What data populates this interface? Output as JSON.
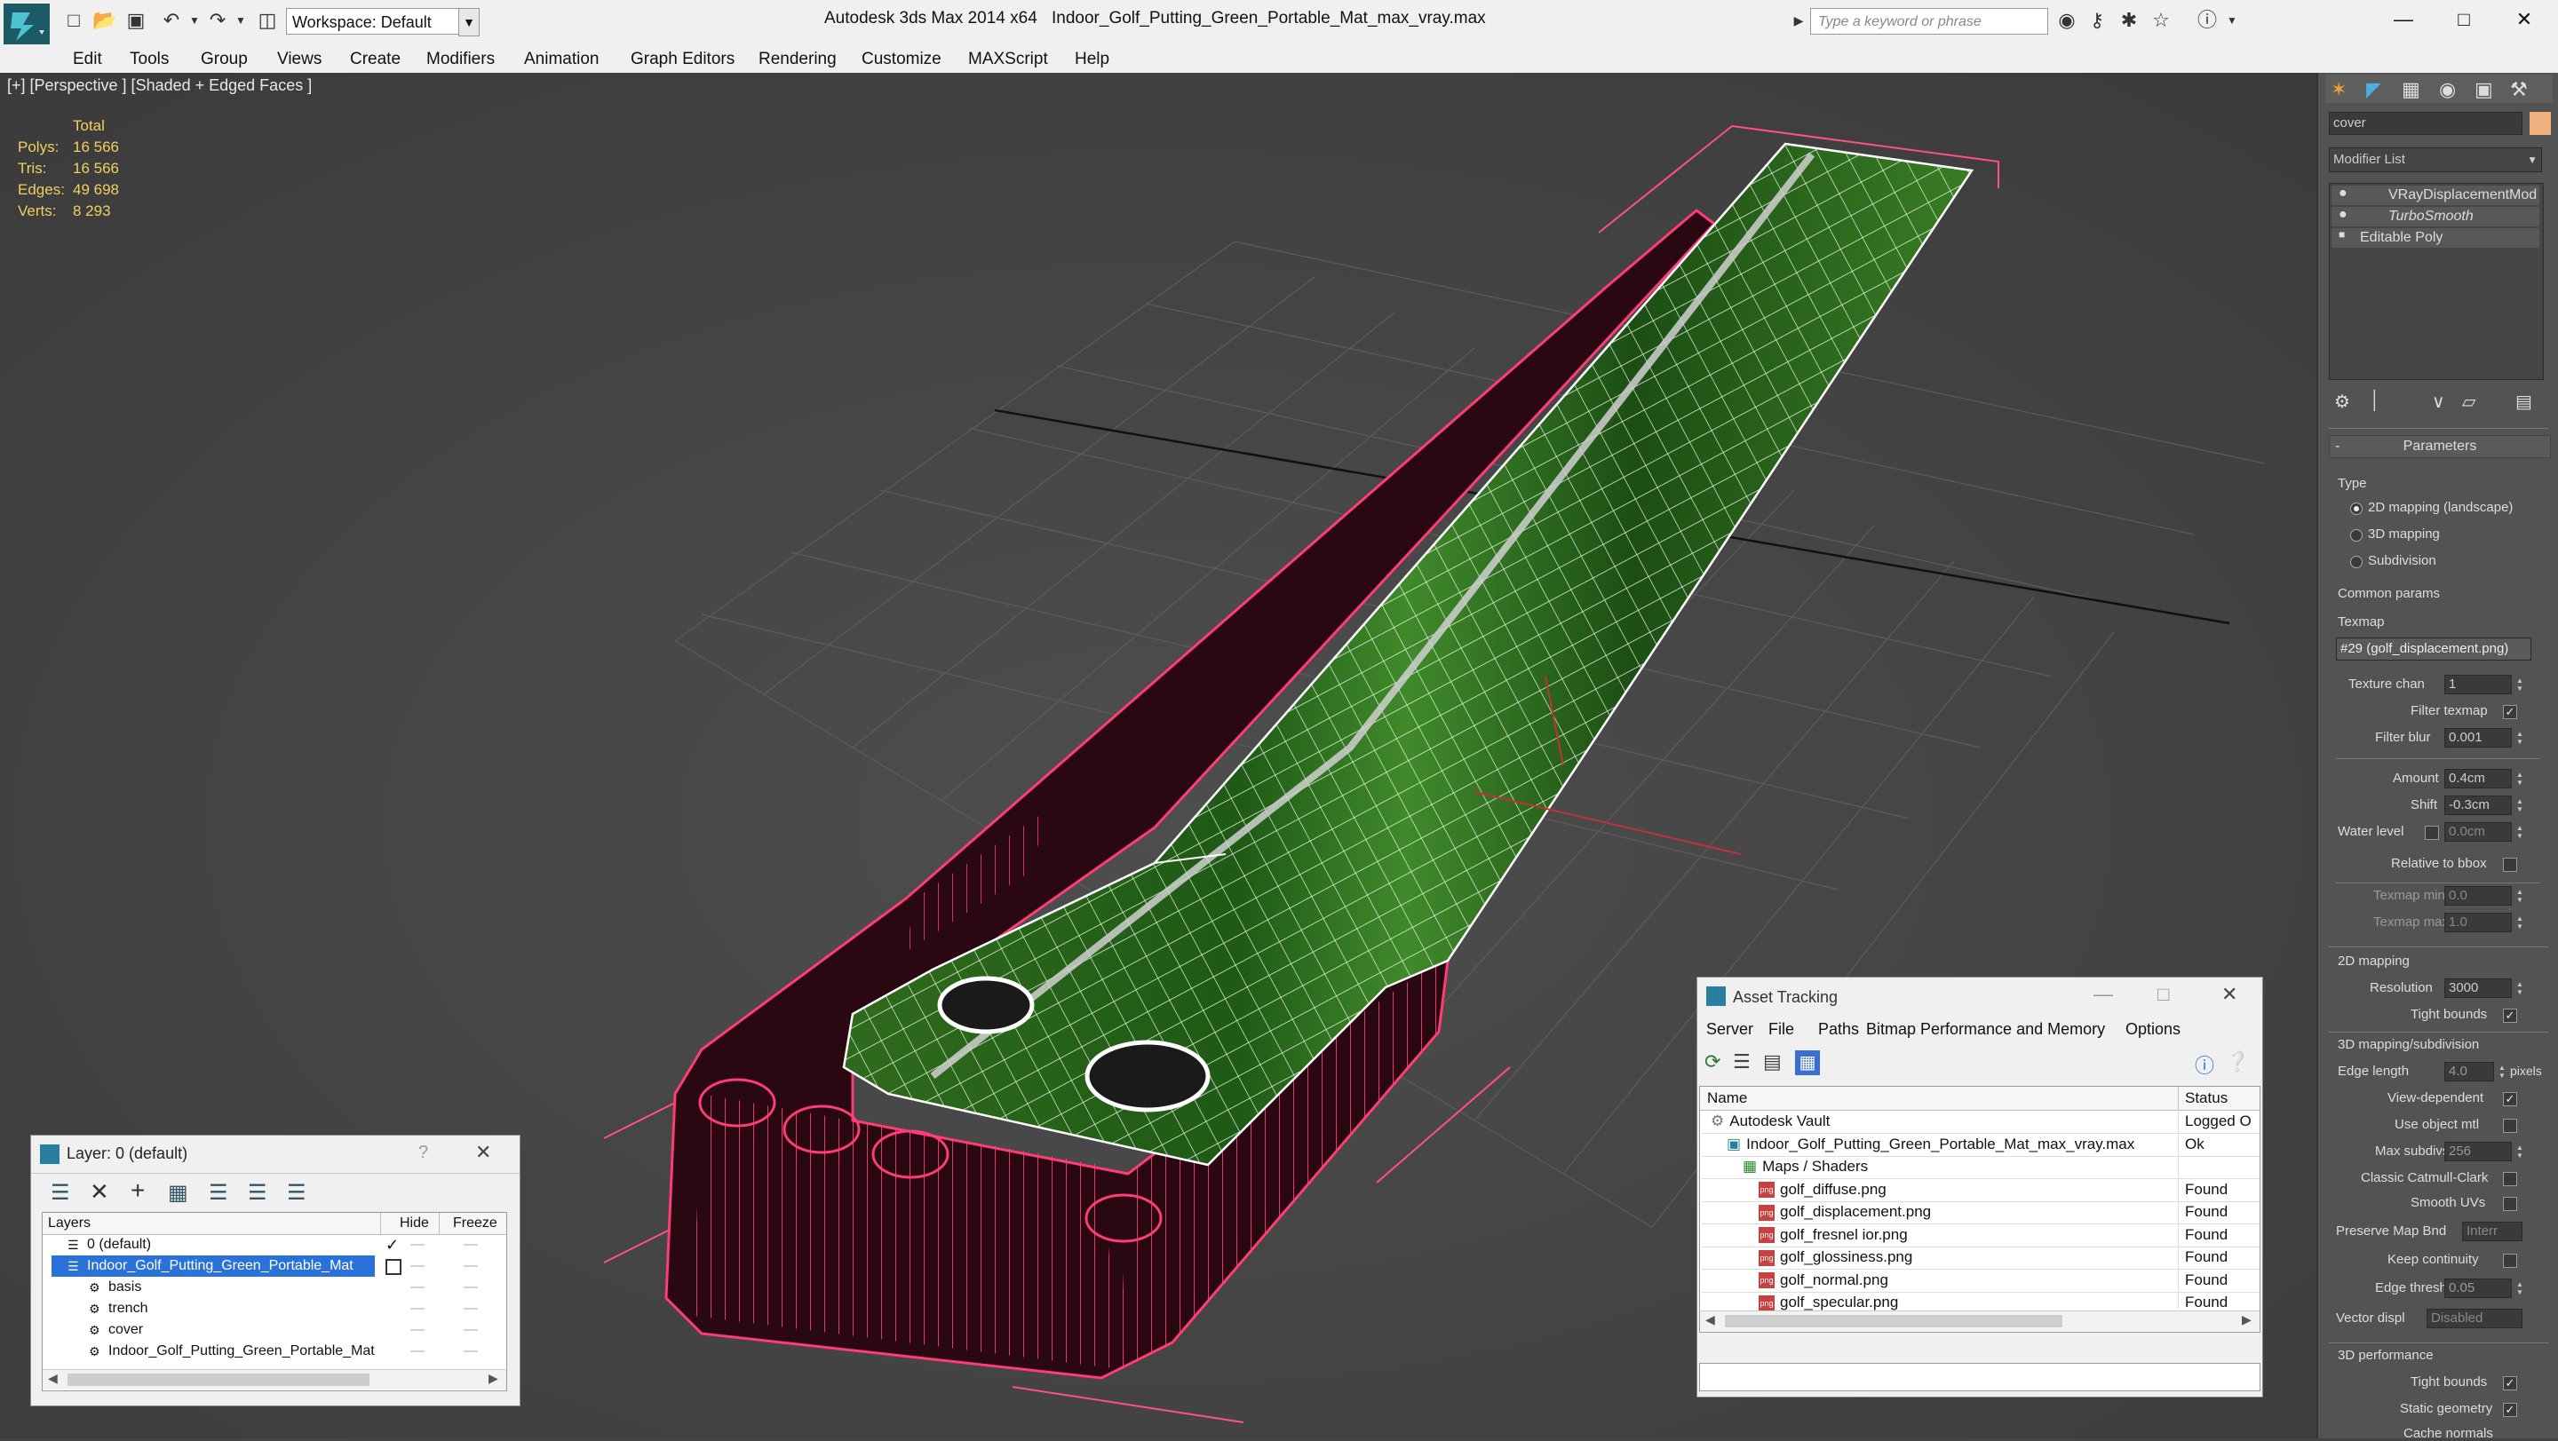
{
  "titlebar": {
    "workspace": "Workspace: Default",
    "app_title": "Autodesk 3ds Max  2014 x64",
    "file_title": "Indoor_Golf_Putting_Green_Portable_Mat_max_vray.max",
    "search_placeholder": "Type a keyword or phrase"
  },
  "menubar": [
    "Edit",
    "Tools",
    "Group",
    "Views",
    "Create",
    "Modifiers",
    "Animation",
    "Graph Editors",
    "Rendering",
    "Customize",
    "MAXScript",
    "Help"
  ],
  "viewport": {
    "label": "[+] [Perspective ] [Shaded + Edged Faces ]",
    "stats_header": "Total",
    "stats": [
      {
        "label": "Polys:",
        "value": "16 566"
      },
      {
        "label": "Tris:",
        "value": "16 566"
      },
      {
        "label": "Edges:",
        "value": "49 698"
      },
      {
        "label": "Verts:",
        "value": "8 293"
      }
    ]
  },
  "command_panel": {
    "object_name": "cover",
    "object_color": "#f0b080",
    "modifier_list_label": "Modifier List",
    "stack": [
      "VRayDisplacementMod",
      "TurboSmooth",
      "Editable Poly"
    ],
    "rollout_title": "Parameters",
    "type_label": "Type",
    "type_options": [
      "2D mapping (landscape)",
      "3D mapping",
      "Subdivision"
    ],
    "type_selected": 0,
    "common_params": "Common params",
    "texmap_label": "Texmap",
    "texmap_value": "#29 (golf_displacement.png)",
    "texture_chan_label": "Texture chan",
    "texture_chan_value": "1",
    "filter_texmap_label": "Filter texmap",
    "filter_blur_label": "Filter blur",
    "filter_blur_value": "0.001",
    "amount_label": "Amount",
    "amount_value": "0.4cm",
    "shift_label": "Shift",
    "shift_value": "-0.3cm",
    "water_level_label": "Water level",
    "water_level_value": "0.0cm",
    "relative_bbox_label": "Relative to bbox",
    "texmap_min_label": "Texmap min",
    "texmap_min_value": "0.0",
    "texmap_max_label": "Texmap max",
    "texmap_max_value": "1.0",
    "mapping2d_label": "2D mapping",
    "resolution_label": "Resolution",
    "resolution_value": "3000",
    "tight_bounds_label": "Tight bounds",
    "mapping3d_label": "3D mapping/subdivision",
    "edge_length_label": "Edge length",
    "edge_length_value": "4.0",
    "edge_length_unit": "pixels",
    "view_dependent_label": "View-dependent",
    "use_object_mtl_label": "Use object mtl",
    "max_subdivs_label": "Max subdivs",
    "max_subdivs_value": "256",
    "classic_cc_label": "Classic Catmull-Clark",
    "smooth_uvs_label": "Smooth UVs",
    "preserve_map_label": "Preserve Map Bnd",
    "preserve_map_value": "Interr",
    "keep_continuity_label": "Keep continuity",
    "edge_thresh_label": "Edge thresh",
    "edge_thresh_value": "0.05",
    "vector_displ_label": "Vector displ",
    "vector_displ_value": "Disabled",
    "perf_label": "3D performance",
    "perf_tight_bounds_label": "Tight bounds",
    "static_geometry_label": "Static geometry",
    "cache_normals_label": "Cache normals"
  },
  "layer_dialog": {
    "title": "Layer: 0 (default)",
    "help": "?",
    "columns": [
      "Layers",
      "Hide",
      "Freeze"
    ],
    "rows": [
      {
        "name": "0 (default)",
        "indent": 0
      },
      {
        "name": "Indoor_Golf_Putting_Green_Portable_Mat",
        "indent": 0,
        "selected": true
      },
      {
        "name": "basis",
        "indent": 1
      },
      {
        "name": "trench",
        "indent": 1
      },
      {
        "name": "cover",
        "indent": 1
      },
      {
        "name": "Indoor_Golf_Putting_Green_Portable_Mat",
        "indent": 1
      }
    ]
  },
  "asset_dialog": {
    "title": "Asset Tracking",
    "menu": [
      "Server",
      "File",
      "Paths",
      "Bitmap Performance and Memory",
      "Options"
    ],
    "columns": [
      "Name",
      "Status"
    ],
    "rows": [
      {
        "name": "Autodesk Vault",
        "status": "Logged O",
        "indent": 0,
        "kind": "vault"
      },
      {
        "name": "Indoor_Golf_Putting_Green_Portable_Mat_max_vray.max",
        "status": "Ok",
        "indent": 1,
        "kind": "max"
      },
      {
        "name": "Maps / Shaders",
        "status": "",
        "indent": 2,
        "kind": "folder"
      },
      {
        "name": "golf_diffuse.png",
        "status": "Found",
        "indent": 3,
        "kind": "png"
      },
      {
        "name": "golf_displacement.png",
        "status": "Found",
        "indent": 3,
        "kind": "png"
      },
      {
        "name": "golf_fresnel ior.png",
        "status": "Found",
        "indent": 3,
        "kind": "png"
      },
      {
        "name": "golf_glossiness.png",
        "status": "Found",
        "indent": 3,
        "kind": "png"
      },
      {
        "name": "golf_normal.png",
        "status": "Found",
        "indent": 3,
        "kind": "png"
      },
      {
        "name": "golf_specular.png",
        "status": "Found",
        "indent": 3,
        "kind": "png"
      }
    ]
  }
}
